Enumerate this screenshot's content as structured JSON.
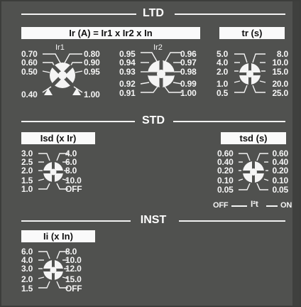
{
  "sections": {
    "ltd": "LTD",
    "std": "STD",
    "inst": "INST"
  },
  "colors": {
    "panel": "#50514f",
    "text": "#f4f4f4",
    "label_box": "#fafafa"
  },
  "ltd": {
    "ir_header": "Ir (A) = Ir1 x Ir2 x In",
    "ir1": {
      "name": "Ir1",
      "left": [
        "0.70",
        "0.60",
        "0.50",
        "0.40"
      ],
      "right": [
        "0.80",
        "0.90",
        "0.95",
        "1.00"
      ]
    },
    "ir2": {
      "name": "Ir2",
      "left": [
        "0.95",
        "0.94",
        "0.93",
        "0.92",
        "0.91"
      ],
      "right": [
        "0.96",
        "0.97",
        "0.98",
        "0.99",
        "1.00"
      ]
    },
    "tr": {
      "header": "tr (s)",
      "left": [
        "5.0",
        "4.0",
        "2.0",
        "1.0",
        "0.5"
      ],
      "right": [
        "8.0",
        "10.0",
        "15.0",
        "20.0",
        "25.0"
      ]
    }
  },
  "std": {
    "isd": {
      "header": "Isd (x Ir)",
      "left": [
        "3.0",
        "2.5",
        "2.0",
        "1.5",
        "1.0"
      ],
      "right": [
        "4.0",
        "6.0",
        "8.0",
        "10.0",
        "OFF"
      ]
    },
    "tsd": {
      "header": "tsd (s)",
      "left": [
        "0.60",
        "0.40",
        "0.20",
        "0.10",
        "0.05"
      ],
      "right": [
        "0.60",
        "0.40",
        "0.20",
        "0.10",
        "0.05"
      ],
      "footer": {
        "off": "OFF",
        "i2t": "I²t",
        "on": "ON"
      }
    }
  },
  "inst": {
    "ii": {
      "header": "Ii (x In)",
      "left": [
        "6.0",
        "4.0",
        "3.0",
        "2.0",
        "1.5"
      ],
      "right": [
        "8.0",
        "10.0",
        "12.0",
        "15.0",
        "OFF"
      ]
    }
  }
}
